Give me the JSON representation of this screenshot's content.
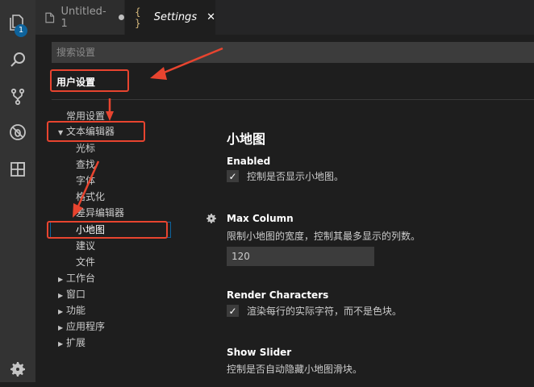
{
  "tabs": [
    {
      "label": "Untitled-1",
      "dirty": true
    },
    {
      "label": "Settings",
      "icon_glyph": "{ }"
    }
  ],
  "activity_bar": {
    "items": [
      "explorer-icon",
      "search-icon",
      "source-control-icon",
      "debug-icon",
      "extensions-icon"
    ],
    "badge": "1",
    "bottom": "gear-icon"
  },
  "settings": {
    "search_placeholder": "搜索设置",
    "user_settings": "用户设置",
    "tree": {
      "common": "常用设置",
      "text_editor": "文本编辑器",
      "children": [
        "光标",
        "查找",
        "字体",
        "格式化",
        "差异编辑器",
        "小地图",
        "建议",
        "文件"
      ],
      "groups": [
        "工作台",
        "窗口",
        "功能",
        "应用程序",
        "扩展"
      ]
    },
    "section_title": "小地图",
    "items": {
      "enabled": {
        "title": "Enabled",
        "desc": "控制是否显示小地图。",
        "checked": true
      },
      "max_column": {
        "title": "Max Column",
        "desc": "限制小地图的宽度，控制其最多显示的列数。",
        "value": "120"
      },
      "render_characters": {
        "title": "Render Characters",
        "desc": "渲染每行的实际字符，而不是色块。",
        "checked": true
      },
      "show_slider": {
        "title": "Show Slider",
        "desc": "控制是否自动隐藏小地图滑块。"
      }
    }
  },
  "colors": {
    "annotation": "#e8442f",
    "activity_bar": "#333333",
    "editor_bg": "#1e1e1e",
    "badge": "#0e639c"
  }
}
